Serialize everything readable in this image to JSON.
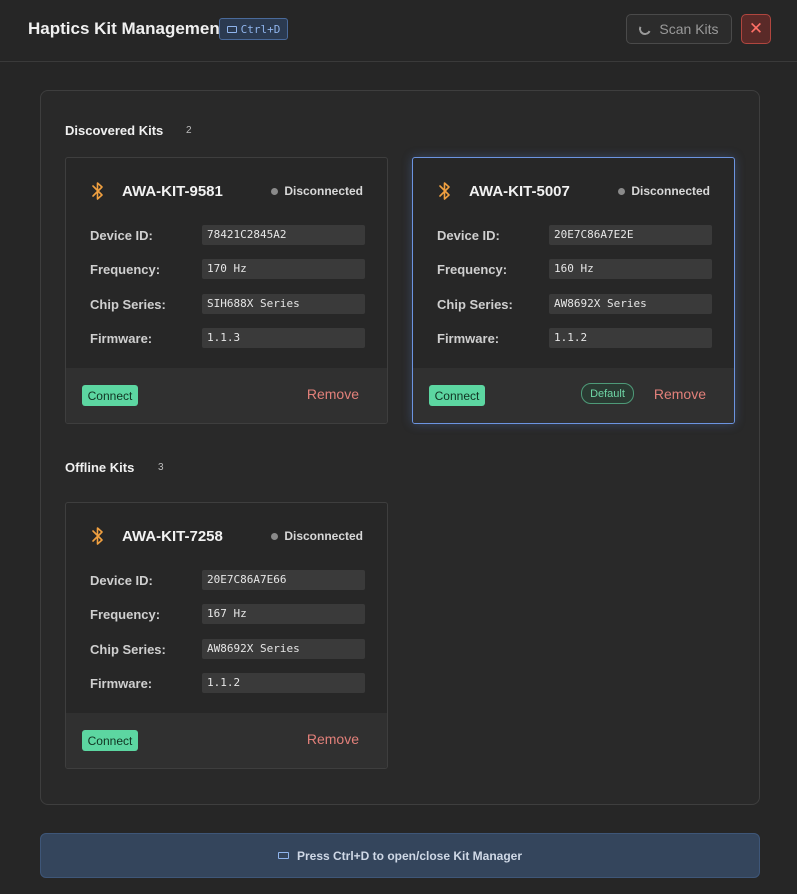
{
  "header": {
    "title": "Haptics Kit Management",
    "shortcut": "Ctrl+D",
    "scan_label": "Scan Kits",
    "close_glyph": "✕"
  },
  "sections": {
    "discovered": {
      "title": "Discovered Kits",
      "count": "2"
    },
    "offline": {
      "title": "Offline Kits",
      "count": "3"
    }
  },
  "labels": {
    "device_id": "Device ID:",
    "frequency": "Frequency:",
    "chip_series": "Chip Series:",
    "firmware": "Firmware:",
    "connect": "Connect",
    "remove": "Remove",
    "default": "Default"
  },
  "kits": [
    {
      "name": "AWA-KIT-9581",
      "status": "Disconnected",
      "device_id": "78421C2845A2",
      "frequency": "170 Hz",
      "chip_series": "SIH688X Series",
      "firmware": "1.1.3"
    },
    {
      "name": "AWA-KIT-5007",
      "status": "Disconnected",
      "device_id": "20E7C86A7E2E",
      "frequency": "160 Hz",
      "chip_series": "AW8692X Series",
      "firmware": "1.1.2"
    },
    {
      "name": "AWA-KIT-7258",
      "status": "Disconnected",
      "device_id": "20E7C86A7E66",
      "frequency": "167 Hz",
      "chip_series": "AW8692X Series",
      "firmware": "1.1.2"
    }
  ],
  "footer": {
    "hint": "Press Ctrl+D to open/close Kit Manager"
  },
  "colors": {
    "accent_blue": "#6c94e0",
    "connect_green": "#5cd6a1",
    "bluetooth_orange": "#f0a040",
    "remove_red": "#e2807a",
    "close_red": "#ff6f66"
  },
  "icons": {
    "bluetooth": "bluetooth-icon",
    "keyboard": "keyboard-icon",
    "spinner": "loading-spinner-icon",
    "close": "close-icon"
  }
}
